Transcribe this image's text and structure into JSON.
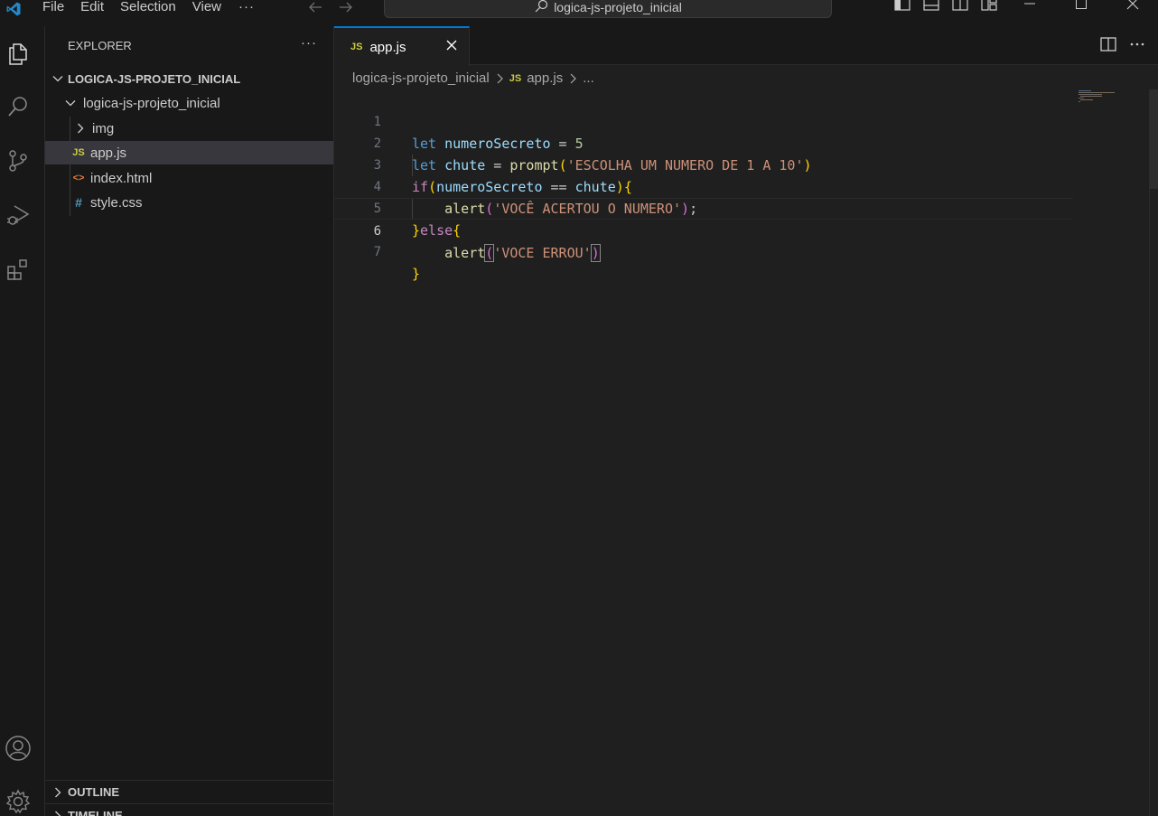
{
  "titlebar": {
    "menu": [
      "File",
      "Edit",
      "Selection",
      "View"
    ],
    "more": "···",
    "search_text": "logica-js-projeto_inicial"
  },
  "sidebar": {
    "title": "EXPLORER",
    "more": "···",
    "root": "LOGICA-JS-PROJETO_INICIAL",
    "folder": "logica-js-projeto_inicial",
    "items": [
      {
        "label": "img",
        "type": "folder"
      },
      {
        "label": "app.js",
        "type": "js",
        "badge": "JS"
      },
      {
        "label": "index.html",
        "type": "html",
        "badge": "<>"
      },
      {
        "label": "style.css",
        "type": "css",
        "badge": "#"
      }
    ],
    "outline": "OUTLINE",
    "timeline": "TIMELINE"
  },
  "editor": {
    "tab": {
      "badge": "JS",
      "label": "app.js"
    },
    "breadcrumb": {
      "folder": "logica-js-projeto_inicial",
      "badge": "JS",
      "file": "app.js",
      "more": "..."
    },
    "line_numbers": [
      "1",
      "2",
      "3",
      "4",
      "5",
      "6",
      "7"
    ],
    "current_line": "6"
  },
  "code": {
    "l1": {
      "kw": "let",
      "var": "numeroSecreto",
      "op": " = ",
      "num": "5"
    },
    "l2": {
      "kw": "let",
      "var": "chute",
      "op": " = ",
      "fn": "prompt",
      "open": "(",
      "str": "'ESCOLHA UM NUMERO DE 1 A 10'",
      "close": ")"
    },
    "l3": {
      "kw": "if",
      "open": "(",
      "var1": "numeroSecreto",
      "op": " == ",
      "var2": "chute",
      "close": ")",
      "brace": "{"
    },
    "l4": {
      "fn": "alert",
      "open": "(",
      "str": "'VOCÊ ACERTOU O NUMERO'",
      "close": ")",
      "end": ";"
    },
    "l5": {
      "brace1": "}",
      "kw": "else",
      "brace2": "{"
    },
    "l6": {
      "fn": "alert",
      "open": "(",
      "str": "'VOCE ERROU'",
      "close": ")"
    },
    "l7": {
      "brace": "}"
    }
  },
  "colors": {
    "accent": "#0078d4",
    "js_badge": "#cbcb41",
    "html_badge": "#e37933",
    "css_badge": "#519aba"
  }
}
